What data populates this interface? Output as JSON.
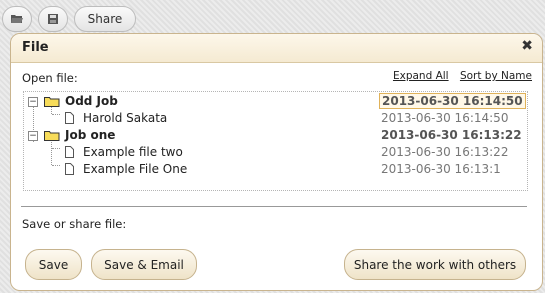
{
  "toolbar": {
    "share_label": "Share"
  },
  "dialog": {
    "title": "File",
    "close_glyph": "✖",
    "open_label": "Open file:",
    "expand_all": "Expand All",
    "sort_by_name": "Sort by Name",
    "tree": [
      {
        "name": "Odd Job",
        "date": "2013-06-30 16:14:50",
        "type": "folder"
      },
      {
        "name": "Harold Sakata",
        "date": "2013-06-30 16:14:50",
        "type": "file"
      },
      {
        "name": "Job one",
        "date": "2013-06-30 16:13:22",
        "type": "folder"
      },
      {
        "name": "Example file two",
        "date": "2013-06-30 16:13:22",
        "type": "file"
      },
      {
        "name": "Example File One",
        "date": "2013-06-30 16:13:1",
        "type": "file"
      }
    ],
    "save_label": "Save or share file:",
    "buttons": {
      "save": "Save",
      "save_email": "Save & Email",
      "share": "Share the work with others"
    },
    "expander_glyph": "−"
  },
  "icons": [
    "folder-open-icon",
    "floppy-disk-icon",
    "close-icon",
    "folder-icon",
    "file-icon"
  ]
}
